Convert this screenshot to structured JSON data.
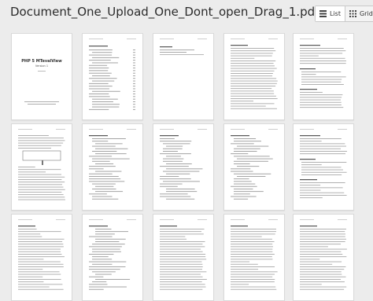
{
  "document": {
    "title": "Document_One_Upload_One_Dont_open_Drag_1.pdf"
  },
  "view_toggle": {
    "list_label": "List",
    "grid_label": "Grid",
    "list_icon": "list-icon",
    "grid_icon": "grid-icon"
  },
  "cover_page": {
    "title": "PHP 5 MTevalView",
    "subtitle": "Version 1"
  },
  "pages": [
    {
      "kind": "cover"
    },
    {
      "kind": "toc"
    },
    {
      "kind": "short"
    },
    {
      "kind": "text"
    },
    {
      "kind": "text-headings"
    },
    {
      "kind": "diagram"
    },
    {
      "kind": "code"
    },
    {
      "kind": "code"
    },
    {
      "kind": "code"
    },
    {
      "kind": "text-headings"
    },
    {
      "kind": "text"
    },
    {
      "kind": "code"
    },
    {
      "kind": "text"
    },
    {
      "kind": "text"
    },
    {
      "kind": "text"
    }
  ],
  "colors": {
    "background": "#ececec",
    "page": "#ffffff",
    "text_lines": "#9a9a9a"
  }
}
